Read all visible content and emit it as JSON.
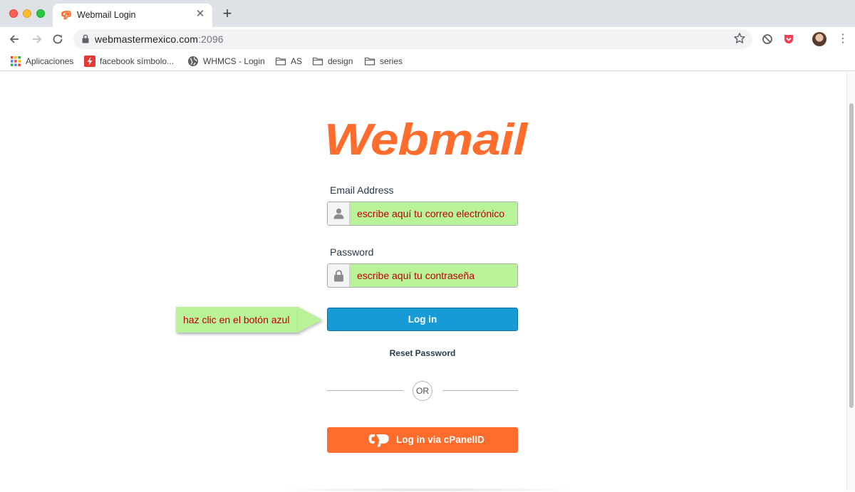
{
  "browser": {
    "tab_title": "Webmail Login",
    "tab_close": "✕",
    "new_tab": "+",
    "url_host": "webmastermexico.com",
    "url_port": ":2096",
    "bookmarks": [
      {
        "label": "Aplicaciones",
        "icon": "apps-grid-icon"
      },
      {
        "label": "facebook símbolo...",
        "icon": "lightning-bolt-icon"
      },
      {
        "label": "WHMCS - Login",
        "icon": "globe-icon"
      },
      {
        "label": "AS",
        "icon": "folder-icon"
      },
      {
        "label": "design",
        "icon": "folder-icon"
      },
      {
        "label": "series",
        "icon": "folder-icon"
      }
    ]
  },
  "page": {
    "logo_text": "Webmail",
    "email_label": "Email Address",
    "email_placeholder": "escribe aquí tu correo electrónico",
    "password_label": "Password",
    "password_placeholder": "escribe aquí tu contraseña",
    "login_button": "Log in",
    "reset_link": "Reset Password",
    "or_text": "OR",
    "cpanelid_button": "Log in via cPanelID",
    "callout_text": "haz clic en el botón azul"
  },
  "colors": {
    "brand_orange": "#ff6c2c",
    "login_blue": "#179bd7",
    "highlight_green": "#b8f39a",
    "annotation_red": "#c00000"
  }
}
